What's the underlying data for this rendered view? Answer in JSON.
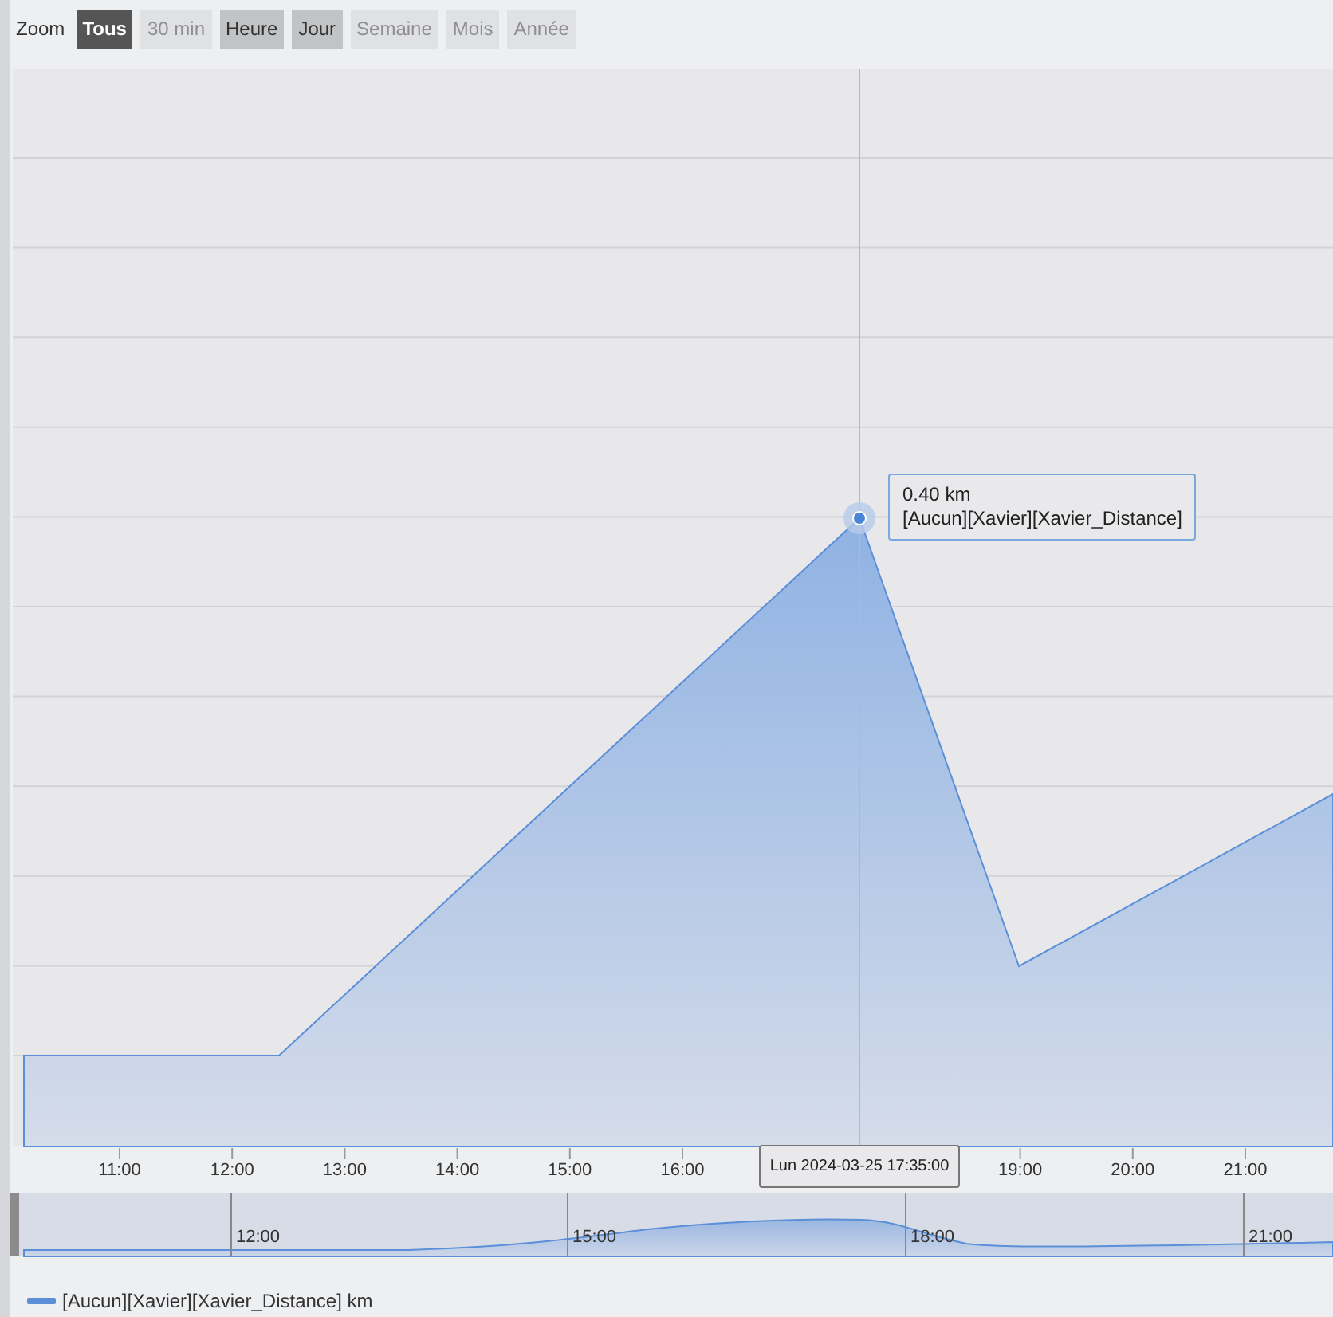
{
  "toolbar": {
    "label": "Zoom",
    "buttons": [
      {
        "label": "Tous",
        "selected": true,
        "disabled": false
      },
      {
        "label": "30 min",
        "selected": false,
        "disabled": true
      },
      {
        "label": "Heure",
        "selected": false,
        "disabled": false
      },
      {
        "label": "Jour",
        "selected": false,
        "disabled": false
      },
      {
        "label": "Semaine",
        "selected": false,
        "disabled": true
      },
      {
        "label": "Mois",
        "selected": false,
        "disabled": true
      },
      {
        "label": "Année",
        "selected": false,
        "disabled": true
      }
    ]
  },
  "chart": {
    "x_axis_labels": [
      "11:00",
      "12:00",
      "13:00",
      "14:00",
      "15:00",
      "16:00",
      "19:00",
      "20:00",
      "21:00"
    ],
    "tooltip": {
      "value": "0.40 km",
      "series": "[Aucun][Xavier][Xavier_Distance]"
    },
    "crosshair_label": "Lun 2024-03-25 17:35:00",
    "navigator_labels": [
      "12:00",
      "15:00",
      "18:00",
      "21:00"
    ]
  },
  "legend": {
    "label": "[Aucun][Xavier][Xavier_Distance] km"
  }
}
